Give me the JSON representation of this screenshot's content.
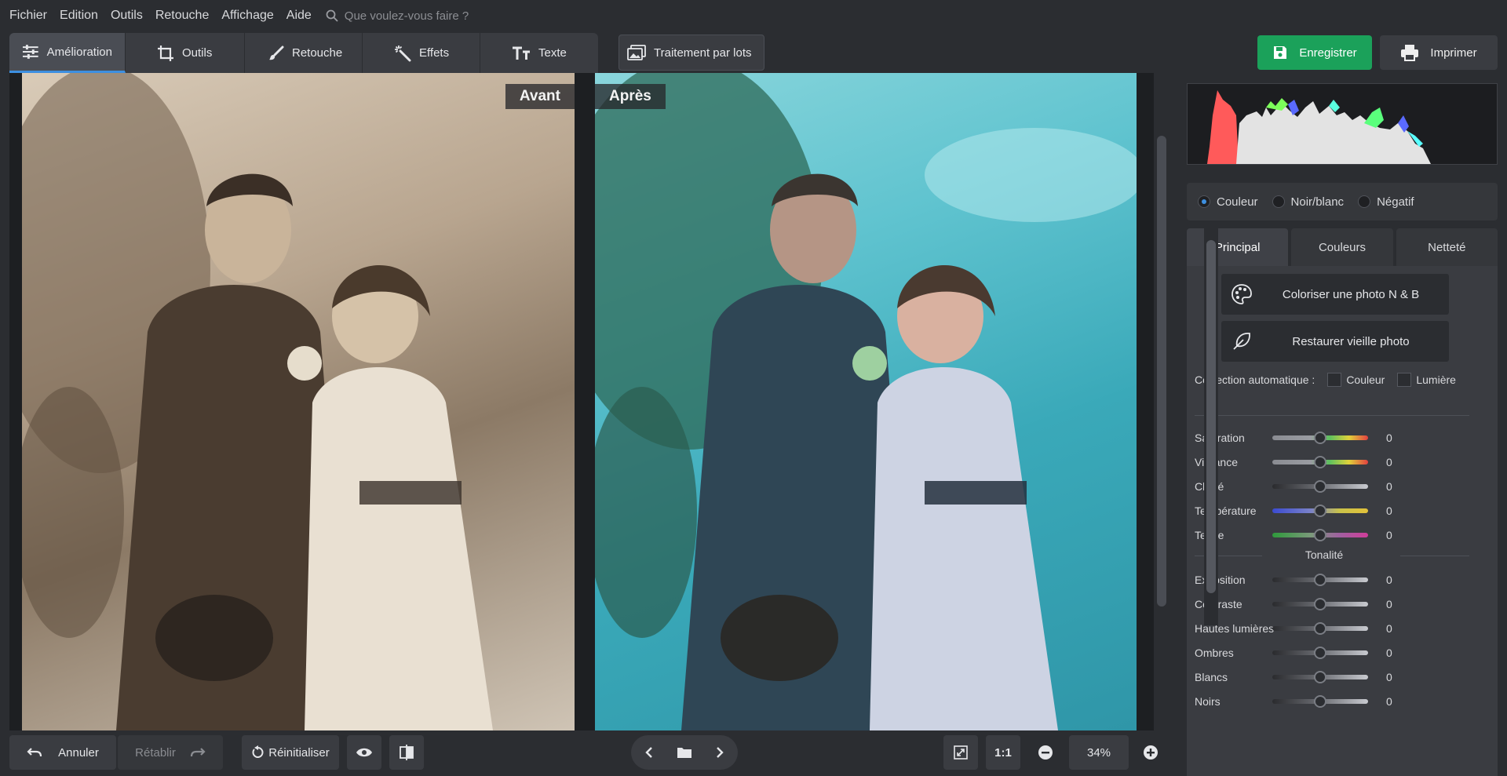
{
  "menu": {
    "items": [
      "Fichier",
      "Edition",
      "Outils",
      "Retouche",
      "Affichage",
      "Aide"
    ],
    "search_placeholder": "Que voulez-vous faire ?"
  },
  "toolbar": {
    "tabs": [
      {
        "label": "Amélioration",
        "icon": "sliders-icon",
        "active": true
      },
      {
        "label": "Outils",
        "icon": "crop-icon"
      },
      {
        "label": "Retouche",
        "icon": "brush-icon"
      },
      {
        "label": "Effets",
        "icon": "magic-wand-icon"
      },
      {
        "label": "Texte",
        "icon": "text-icon"
      }
    ],
    "batch_label": "Traitement par lots",
    "save_label": "Enregistrer",
    "print_label": "Imprimer"
  },
  "photos": {
    "before_label": "Avant",
    "after_label": "Après"
  },
  "bottom": {
    "undo_label": "Annuler",
    "redo_label": "Rétablir",
    "reset_label": "Réinitialiser",
    "one_to_one": "1:1",
    "zoom": "34%"
  },
  "panel": {
    "modes": [
      {
        "label": "Couleur",
        "checked": true
      },
      {
        "label": "Noir/blanc",
        "checked": false
      },
      {
        "label": "Négatif",
        "checked": false
      }
    ],
    "tabs": [
      {
        "label": "Principal",
        "active": true
      },
      {
        "label": "Couleurs",
        "active": false
      },
      {
        "label": "Netteté",
        "active": false
      }
    ],
    "colorize_label": "Coloriser une photo N & B",
    "restore_label": "Restaurer vieille photo",
    "auto_label": "Correction automatique :",
    "auto_color": "Couleur",
    "auto_light": "Lumière",
    "tonalite_label": "Tonalité",
    "sliders_color": [
      {
        "label": "Saturation",
        "value": "0"
      },
      {
        "label": "Vibrance",
        "value": "0"
      },
      {
        "label": "Clarté",
        "value": "0"
      },
      {
        "label": "Température",
        "value": "0"
      },
      {
        "label": "Teinte",
        "value": "0"
      }
    ],
    "sliders_tone": [
      {
        "label": "Exposition",
        "value": "0"
      },
      {
        "label": "Contraste",
        "value": "0"
      },
      {
        "label": "Hautes lumières",
        "value": "0"
      },
      {
        "label": "Ombres",
        "value": "0"
      },
      {
        "label": "Blancs",
        "value": "0"
      },
      {
        "label": "Noirs",
        "value": "0"
      }
    ]
  },
  "colors": {
    "accent": "#3d8fe0",
    "save_green": "#1ba15a"
  }
}
